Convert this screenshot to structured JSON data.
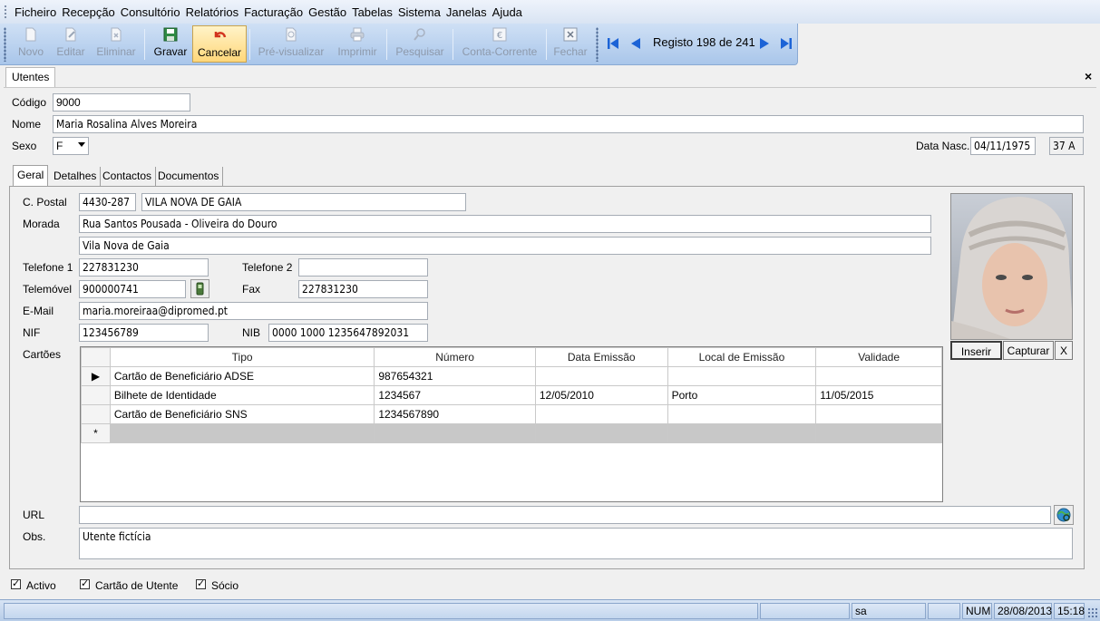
{
  "menu": [
    "Ficheiro",
    "Recepção",
    "Consultório",
    "Relatórios",
    "Facturação",
    "Gestão",
    "Tabelas",
    "Sistema",
    "Janelas",
    "Ajuda"
  ],
  "toolbar": {
    "novo": "Novo",
    "editar": "Editar",
    "eliminar": "Eliminar",
    "gravar": "Gravar",
    "cancelar": "Cancelar",
    "previsualizar": "Pré-visualizar",
    "imprimir": "Imprimir",
    "pesquisar": "Pesquisar",
    "conta_corrente": "Conta-Corrente",
    "fechar": "Fechar",
    "record": "Registo 198 de 241"
  },
  "window": {
    "tab": "Utentes",
    "close": "×"
  },
  "form": {
    "codigo_label": "Código",
    "codigo": "9000",
    "nome_label": "Nome",
    "nome": "Maria Rosalina Alves Moreira",
    "sexo_label": "Sexo",
    "sexo": "F",
    "data_nasc_label": "Data Nasc.",
    "data_nasc": "04/11/1975",
    "idade": "37 A"
  },
  "tabs": [
    "Geral",
    "Detalhes",
    "Contactos",
    "Documentos"
  ],
  "geral": {
    "cpostal_label": "C. Postal",
    "cpostal": "4430-287",
    "localidade": "VILA NOVA DE GAIA",
    "morada_label": "Morada",
    "morada1": "Rua Santos Pousada - Oliveira do Douro",
    "morada2": "Vila Nova de Gaia",
    "tel1_label": "Telefone 1",
    "tel1": "227831230",
    "tel2_label": "Telefone 2",
    "tel2": "",
    "telemovel_label": "Telemóvel",
    "telemovel": "900000741",
    "fax_label": "Fax",
    "fax": "227831230",
    "email_label": "E-Mail",
    "email": "maria.moreiraa@dipromed.pt",
    "nif_label": "NIF",
    "nif": "123456789",
    "nib_label": "NIB",
    "nib": "0000 1000 1235647892031",
    "cartoes_label": "Cartões",
    "url_label": "URL",
    "url": "",
    "obs_label": "Obs.",
    "obs": "Utente fictícia"
  },
  "cards": {
    "headers": [
      "Tipo",
      "Número",
      "Data Emissão",
      "Local de Emissão",
      "Validade"
    ],
    "rows": [
      [
        "Cartão de Beneficiário ADSE",
        "987654321",
        "",
        "",
        ""
      ],
      [
        "Bilhete de Identidade",
        "1234567",
        "12/05/2010",
        "Porto",
        "11/05/2015"
      ],
      [
        "Cartão de Beneficiário SNS",
        "1234567890",
        "",
        "",
        ""
      ]
    ],
    "new_row_marker": "*",
    "current_row_marker": "▶"
  },
  "photo_buttons": {
    "inserir": "Inserir",
    "capturar": "Capturar",
    "remover": "X"
  },
  "checks": {
    "activo": "Activo",
    "cartao_utente": "Cartão de Utente",
    "socio": "Sócio",
    "mark": "✓"
  },
  "status": {
    "user": "sa",
    "num": "NUM",
    "date": "28/08/2013",
    "time": "15:18"
  },
  "icons": [
    "new-doc-icon",
    "edit-icon",
    "delete-icon",
    "save-icon",
    "undo-icon",
    "preview-icon",
    "print-icon",
    "search-icon",
    "euro-icon",
    "close-icon",
    "first-record-icon",
    "prev-record-icon",
    "next-record-icon",
    "last-record-icon",
    "phone-icon",
    "globe-icon"
  ]
}
